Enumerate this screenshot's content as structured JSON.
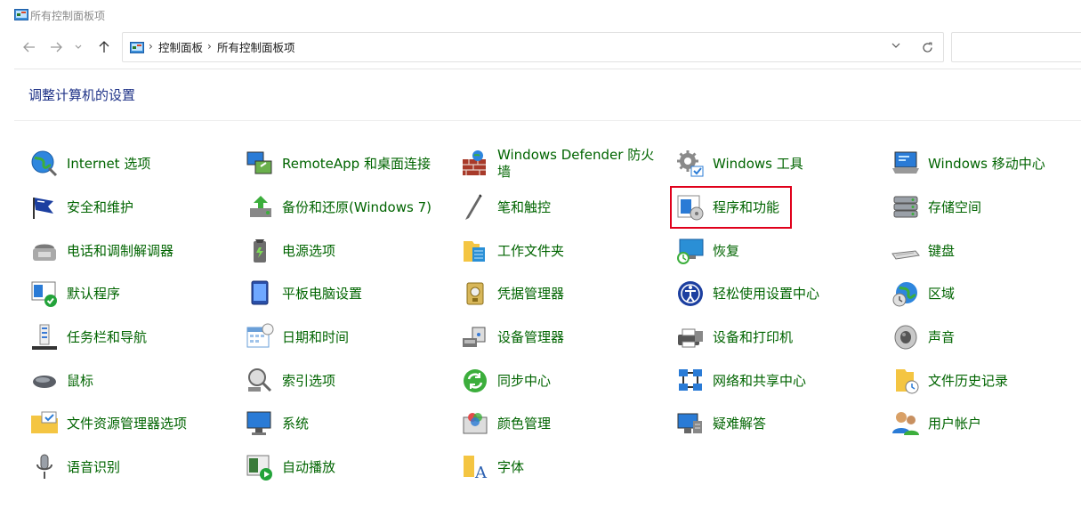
{
  "window": {
    "title": "所有控制面板项"
  },
  "address": {
    "crumbs": [
      "控制面板",
      "所有控制面板项"
    ]
  },
  "heading": "调整计算机的设置",
  "colors": {
    "link": "#006400",
    "heading": "#1e3287",
    "highlight": "#e0001b"
  },
  "items": [
    {
      "label": "Internet 选项",
      "icon": "globe-icon"
    },
    {
      "label": "安全和维护",
      "icon": "flag-icon"
    },
    {
      "label": "电话和调制解调器",
      "icon": "phone-icon"
    },
    {
      "label": "默认程序",
      "icon": "default-programs-icon"
    },
    {
      "label": "任务栏和导航",
      "icon": "taskbar-icon"
    },
    {
      "label": "鼠标",
      "icon": "mouse-icon"
    },
    {
      "label": "文件资源管理器选项",
      "icon": "folder-options-icon"
    },
    {
      "label": "语音识别",
      "icon": "microphone-icon"
    },
    {
      "label": "RemoteApp 和桌面连接",
      "icon": "remoteapp-icon"
    },
    {
      "label": "备份和还原(Windows 7)",
      "icon": "backup-icon"
    },
    {
      "label": "电源选项",
      "icon": "power-icon"
    },
    {
      "label": "平板电脑设置",
      "icon": "tablet-icon"
    },
    {
      "label": "日期和时间",
      "icon": "calendar-icon"
    },
    {
      "label": "索引选项",
      "icon": "index-icon"
    },
    {
      "label": "系统",
      "icon": "system-icon"
    },
    {
      "label": "自动播放",
      "icon": "autoplay-icon"
    },
    {
      "label": "Windows Defender 防火墙",
      "icon": "firewall-icon"
    },
    {
      "label": "笔和触控",
      "icon": "pen-icon"
    },
    {
      "label": "工作文件夹",
      "icon": "work-folders-icon"
    },
    {
      "label": "凭据管理器",
      "icon": "credential-icon"
    },
    {
      "label": "设备管理器",
      "icon": "device-manager-icon"
    },
    {
      "label": "同步中心",
      "icon": "sync-icon"
    },
    {
      "label": "颜色管理",
      "icon": "color-icon"
    },
    {
      "label": "字体",
      "icon": "font-icon"
    },
    {
      "label": "Windows 工具",
      "icon": "tools-icon"
    },
    {
      "label": "程序和功能",
      "icon": "programs-icon"
    },
    {
      "label": "恢复",
      "icon": "recovery-icon"
    },
    {
      "label": "轻松使用设置中心",
      "icon": "ease-of-access-icon"
    },
    {
      "label": "设备和打印机",
      "icon": "printer-icon"
    },
    {
      "label": "网络和共享中心",
      "icon": "network-icon"
    },
    {
      "label": "疑难解答",
      "icon": "troubleshoot-icon"
    },
    {
      "label": "Windows 移动中心",
      "icon": "mobility-icon"
    },
    {
      "label": "存储空间",
      "icon": "storage-icon"
    },
    {
      "label": "键盘",
      "icon": "keyboard-icon"
    },
    {
      "label": "区域",
      "icon": "region-icon"
    },
    {
      "label": "声音",
      "icon": "speaker-icon"
    },
    {
      "label": "文件历史记录",
      "icon": "file-history-icon"
    },
    {
      "label": "用户帐户",
      "icon": "users-icon"
    }
  ]
}
